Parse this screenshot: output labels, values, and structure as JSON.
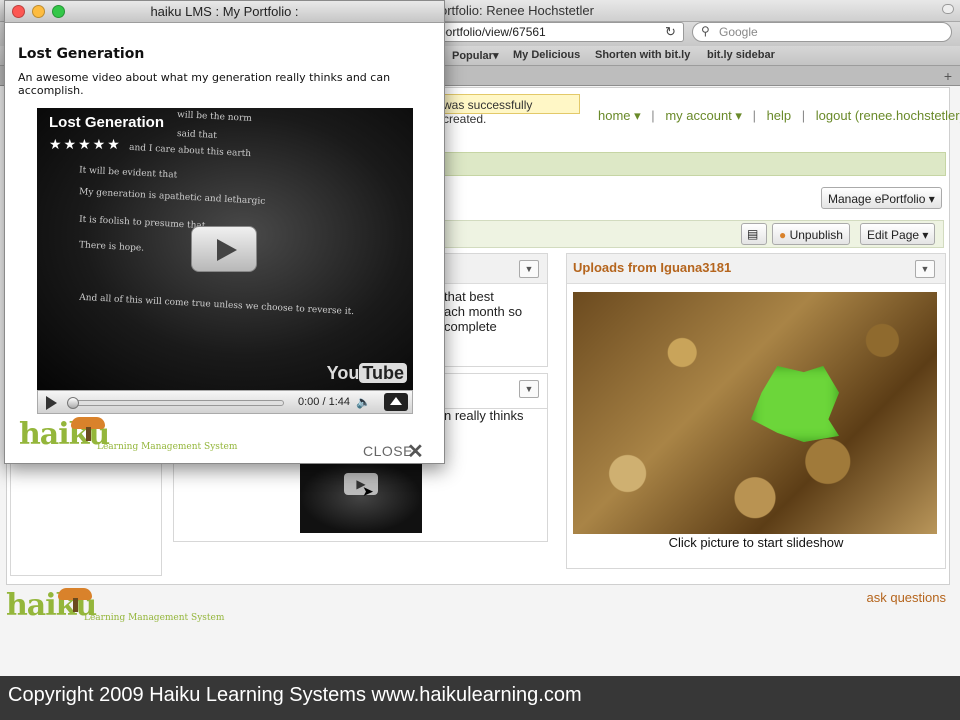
{
  "background_browser": {
    "window_title": "ortfolio: Renee Hochstetler",
    "url": "portfolio/view/67561",
    "search_placeholder": "Google",
    "bookmarks": [
      "Popular▾",
      "My Delicious",
      "Shorten with bit.ly",
      "bit.ly sidebar"
    ],
    "flash_message": "was successfully created.",
    "nav": {
      "home": "home",
      "my_account": "my account",
      "help": "help",
      "logout": "logout (renee.hochstetler)"
    },
    "manage_label": "Manage ePortfolio",
    "unpublish_label": "Unpublish",
    "edit_page_label": "Edit Page",
    "uploads_title": "Uploads from Iguana3181",
    "slideshow_caption": "Click picture to start slideshow",
    "partial_text_1": "that best\nach month so\ncomplete",
    "partial_text_2": "n really thinks",
    "ask_questions": "ask questions",
    "logo": {
      "word": "haiku",
      "tagline": "Learning Management System"
    },
    "copyright": "Copyright 2009 Haiku Learning Systems  www.haikulearning.com"
  },
  "popup": {
    "window_title": "haiku LMS : My Portfolio :",
    "heading": "Lost Generation",
    "description": "An awesome video about what my generation really thinks and can accomplish.",
    "video": {
      "title": "Lost Generation",
      "stars": "★★★★★",
      "poem_lines": [
        "will be the norm",
        "said that",
        "and I care about this earth",
        "It will be evident that",
        "My generation is apathetic and lethargic",
        "It is foolish to presume that",
        "There is hope.",
        "And all of this will come true unless we choose to reverse it."
      ],
      "youtube": "You",
      "youtube_tube": "Tube",
      "time": "0:00 / 1:44",
      "progress": 0.0
    },
    "logo": {
      "word": "haiku",
      "tagline": "Learning Management System"
    },
    "close_label": "CLOSE"
  },
  "colors": {
    "accent": "#b5651d",
    "haiku_green": "#94b63b",
    "nav_green": "#6a8a2a",
    "traffic_red": "#fc5753",
    "traffic_yellow": "#fdbc40",
    "traffic_green": "#33c748"
  }
}
